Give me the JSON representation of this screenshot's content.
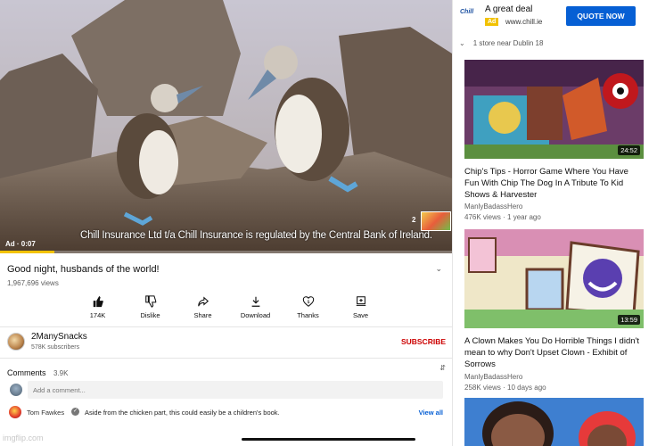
{
  "player": {
    "ad_caption": "Chill Insurance Ltd t/a Chill Insurance is regulated by the Central Bank of Ireland.",
    "ad_time": "Ad · 0:07",
    "ad_count": "2",
    "progress_fraction": 0.12,
    "progress_color": "#f2c200"
  },
  "video": {
    "title": "Good night, husbands of the world!",
    "views": "1,967,696 views"
  },
  "actions": [
    {
      "label": "174K",
      "icon": "thumbs-up-icon"
    },
    {
      "label": "Dislike",
      "icon": "thumbs-down-icon"
    },
    {
      "label": "Share",
      "icon": "share-icon"
    },
    {
      "label": "Download",
      "icon": "download-icon"
    },
    {
      "label": "Thanks",
      "icon": "thanks-icon"
    },
    {
      "label": "Save",
      "icon": "save-icon"
    }
  ],
  "channel": {
    "name": "2ManySnacks",
    "subscribers": "578K subscribers",
    "subscribe_label": "SUBSCRIBE",
    "subscribe_color": "#cc0000"
  },
  "comments": {
    "label": "Comments",
    "count": "3.9K",
    "placeholder": "Add a comment...",
    "top_comment": {
      "author": "Tom Fawkes",
      "text": "Aside from the chicken part, this could easily be a children's book."
    },
    "view_all": "View all"
  },
  "sidebar_ad": {
    "brand": "Chill",
    "headline": "A great deal",
    "badge": "Ad",
    "url": "www.chill.ie",
    "cta": "QUOTE NOW",
    "store": "1 store near Dublin 18",
    "cta_color": "#065fd4"
  },
  "related": [
    {
      "title": "Chip's Tips - Horror Game Where You Have Fun With Chip The Dog In A Tribute To Kid Shows & Harvester",
      "channel": "ManlyBadassHero",
      "meta": "476K views · 1 year ago",
      "duration": "24:52"
    },
    {
      "title": "A Clown Makes You Do Horrible Things I didn't mean to why Don't Upset Clown - Exhibit of Sorrows",
      "channel": "ManlyBadassHero",
      "meta": "258K views · 10 days ago",
      "duration": "13:59"
    }
  ],
  "watermark": "imgflip.com"
}
